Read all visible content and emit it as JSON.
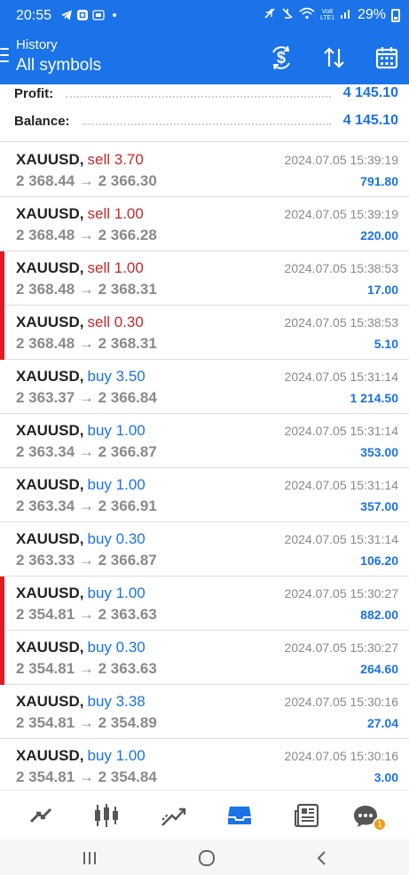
{
  "status_bar": {
    "time": "20:55",
    "battery": "29%",
    "network": "Vo8 LTE1",
    "icons": [
      "telegram-icon",
      "app-box-icon",
      "sim-icon",
      "mute-icon",
      "wifi-icon",
      "signal-icon",
      "battery-icon"
    ]
  },
  "app_bar": {
    "title_small": "History",
    "title_large": "All symbols",
    "actions": [
      "dollar-cycle-icon",
      "sort-icon",
      "calendar-icon"
    ]
  },
  "summary": {
    "profit_label": "Profit:",
    "profit_value": "4 145.10",
    "balance_label": "Balance:",
    "balance_value": "4 145.10"
  },
  "deals": [
    {
      "symbol": "XAUUSD,",
      "type": "sell",
      "volume_text": "sell 3.70",
      "prices": "2 368.44 → 2 366.30",
      "time": "2024.07.05 15:39:19",
      "profit": "791.80",
      "marked": false
    },
    {
      "symbol": "XAUUSD,",
      "type": "sell",
      "volume_text": "sell 1.00",
      "prices": "2 368.48 → 2 366.28",
      "time": "2024.07.05 15:39:19",
      "profit": "220.00",
      "marked": false
    },
    {
      "symbol": "XAUUSD,",
      "type": "sell",
      "volume_text": "sell 1.00",
      "prices": "2 368.48 → 2 368.31",
      "time": "2024.07.05 15:38:53",
      "profit": "17.00",
      "marked": true
    },
    {
      "symbol": "XAUUSD,",
      "type": "sell",
      "volume_text": "sell 0.30",
      "prices": "2 368.48 → 2 368.31",
      "time": "2024.07.05 15:38:53",
      "profit": "5.10",
      "marked": true
    },
    {
      "symbol": "XAUUSD,",
      "type": "buy",
      "volume_text": "buy 3.50",
      "prices": "2 363.37 → 2 366.84",
      "time": "2024.07.05 15:31:14",
      "profit": "1 214.50",
      "marked": false
    },
    {
      "symbol": "XAUUSD,",
      "type": "buy",
      "volume_text": "buy 1.00",
      "prices": "2 363.34 → 2 366.87",
      "time": "2024.07.05 15:31:14",
      "profit": "353.00",
      "marked": false
    },
    {
      "symbol": "XAUUSD,",
      "type": "buy",
      "volume_text": "buy 1.00",
      "prices": "2 363.34 → 2 366.91",
      "time": "2024.07.05 15:31:14",
      "profit": "357.00",
      "marked": false
    },
    {
      "symbol": "XAUUSD,",
      "type": "buy",
      "volume_text": "buy 0.30",
      "prices": "2 363.33 → 2 366.87",
      "time": "2024.07.05 15:31:14",
      "profit": "106.20",
      "marked": false
    },
    {
      "symbol": "XAUUSD,",
      "type": "buy",
      "volume_text": "buy 1.00",
      "prices": "2 354.81 → 2 363.63",
      "time": "2024.07.05 15:30:27",
      "profit": "882.00",
      "marked": true
    },
    {
      "symbol": "XAUUSD,",
      "type": "buy",
      "volume_text": "buy 0.30",
      "prices": "2 354.81 → 2 363.63",
      "time": "2024.07.05 15:30:27",
      "profit": "264.60",
      "marked": true
    },
    {
      "symbol": "XAUUSD,",
      "type": "buy",
      "volume_text": "buy 3.38",
      "prices": "2 354.81 → 2 354.89",
      "time": "2024.07.05 15:30:16",
      "profit": "27.04",
      "marked": false
    },
    {
      "symbol": "XAUUSD,",
      "type": "buy",
      "volume_text": "buy 1.00",
      "prices": "2 354.81 → 2 354.84",
      "time": "2024.07.05 15:30:16",
      "profit": "3.00",
      "marked": false
    }
  ],
  "bottom_nav": {
    "items": [
      "quotes-icon",
      "chart-icon",
      "trade-icon",
      "history-icon",
      "news-icon",
      "chat-icon"
    ],
    "active": "history-icon",
    "chat_badge": "1"
  },
  "system_nav": [
    "recents-icon",
    "home-icon",
    "back-icon"
  ],
  "colors": {
    "header": "#1a73e8",
    "accent": "#1a73e8",
    "sell": "#c62828",
    "marker": "#e31b23",
    "badge": "#f39c12"
  }
}
